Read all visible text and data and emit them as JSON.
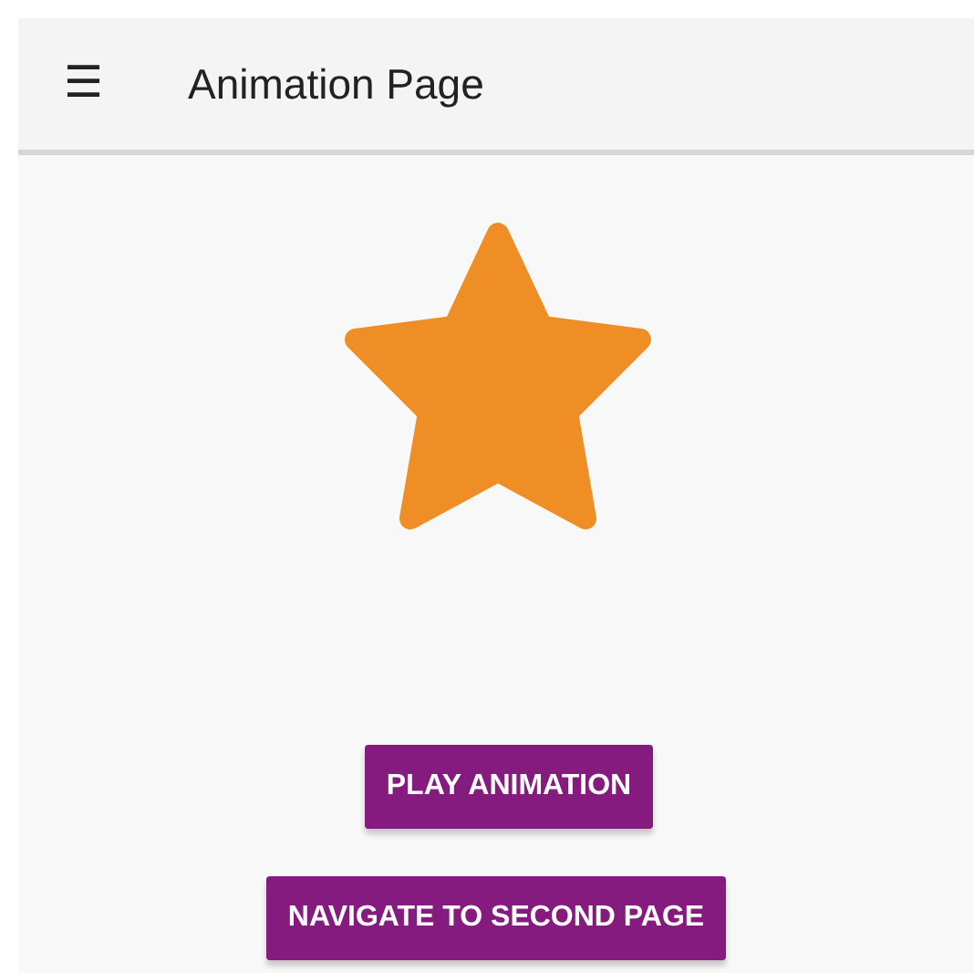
{
  "app_bar": {
    "menu_icon": "☰",
    "title": "Animation Page"
  },
  "buttons": [
    {
      "label": "PLAY ANIMATION"
    },
    {
      "label": "NAVIGATE TO SECOND PAGE"
    }
  ]
}
